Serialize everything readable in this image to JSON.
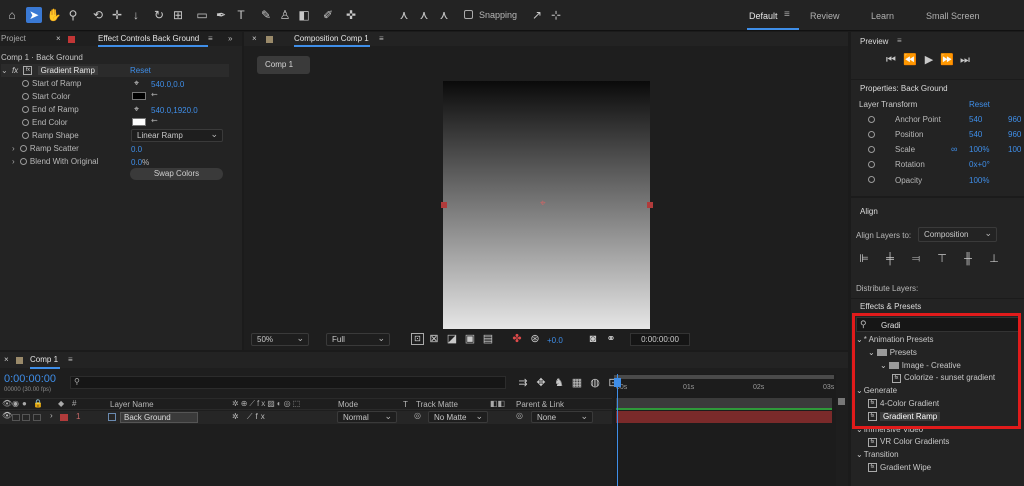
{
  "toolbar": {
    "snapping_label": "Snapping",
    "workspaces": [
      "Default",
      "Review",
      "Learn",
      "Small Screen"
    ]
  },
  "left_panel": {
    "tab_project": "Project",
    "tab_effect_controls": "Effect Controls Back Ground",
    "breadcrumb": "Comp 1 · Back Ground",
    "effect_name": "Gradient Ramp",
    "reset": "Reset",
    "props": [
      {
        "label": "Start of Ramp",
        "value": "540.0,0.0"
      },
      {
        "label": "Start Color",
        "value": ""
      },
      {
        "label": "End of Ramp",
        "value": "540.0,1920.0"
      },
      {
        "label": "End Color",
        "value": ""
      },
      {
        "label": "Ramp Shape",
        "value": "Linear Ramp"
      },
      {
        "label": "Ramp Scatter",
        "value": "0.0"
      },
      {
        "label": "Blend With Original",
        "value": "0.0",
        "unit": "%"
      }
    ],
    "swap_button": "Swap Colors"
  },
  "comp_panel": {
    "tab_label": "Composition Comp 1",
    "comp_tab": "Comp 1",
    "zoom": "50%",
    "resolution": "Full",
    "exposure": "+0.0",
    "timecode": "0:00:00:00"
  },
  "preview": {
    "title": "Preview"
  },
  "properties": {
    "title": "Properties: Back Ground",
    "section": "Layer Transform",
    "reset": "Reset",
    "items": [
      {
        "label": "Anchor Point",
        "v1": "540",
        "v2": "960"
      },
      {
        "label": "Position",
        "v1": "540",
        "v2": "960"
      },
      {
        "label": "Scale",
        "v1": "100%",
        "v2": "100"
      },
      {
        "label": "Rotation",
        "v1": "0x+0°",
        "v2": ""
      },
      {
        "label": "Opacity",
        "v1": "100%",
        "v2": ""
      }
    ]
  },
  "align": {
    "title": "Align",
    "align_to_label": "Align Layers to:",
    "align_to_value": "Composition",
    "distribute_label": "Distribute Layers:"
  },
  "effects": {
    "title": "Effects & Presets",
    "search_value": "Gradi",
    "tree": [
      {
        "label": "* Animation Presets",
        "indent": 0,
        "type": "cat"
      },
      {
        "label": "Presets",
        "indent": 1,
        "type": "folder"
      },
      {
        "label": "Image - Creative",
        "indent": 2,
        "type": "folder"
      },
      {
        "label": "Colorize - sunset gradient",
        "indent": 3,
        "type": "fx"
      },
      {
        "label": "Generate",
        "indent": 0,
        "type": "cat"
      },
      {
        "label": "4-Color Gradient",
        "indent": 1,
        "type": "fx"
      },
      {
        "label": "Gradient Ramp",
        "indent": 1,
        "type": "fx",
        "selected": true
      },
      {
        "label": "Immersive Video",
        "indent": 0,
        "type": "cat"
      },
      {
        "label": "VR Color Gradients",
        "indent": 1,
        "type": "fx"
      },
      {
        "label": "Transition",
        "indent": 0,
        "type": "cat"
      },
      {
        "label": "Gradient Wipe",
        "indent": 1,
        "type": "fx"
      }
    ]
  },
  "timeline": {
    "tab_label": "Comp 1",
    "timecode": "0:00:00:00",
    "fps": "00000 (30.00 fps)",
    "columns": {
      "layer_name": "Layer Name",
      "mode": "Mode",
      "t": "T",
      "track_matte": "Track Matte",
      "parent": "Parent & Link"
    },
    "layer": {
      "index": "1",
      "name": "Back Ground",
      "mode": "Normal",
      "matte": "No Matte",
      "parent": "None"
    },
    "ruler": [
      "00s",
      "01s",
      "02s",
      "03s"
    ]
  },
  "colors": {
    "accent": "#3f8ee8",
    "highlight_red": "#e11b1b",
    "layer_bar": "#7a2a2a"
  }
}
